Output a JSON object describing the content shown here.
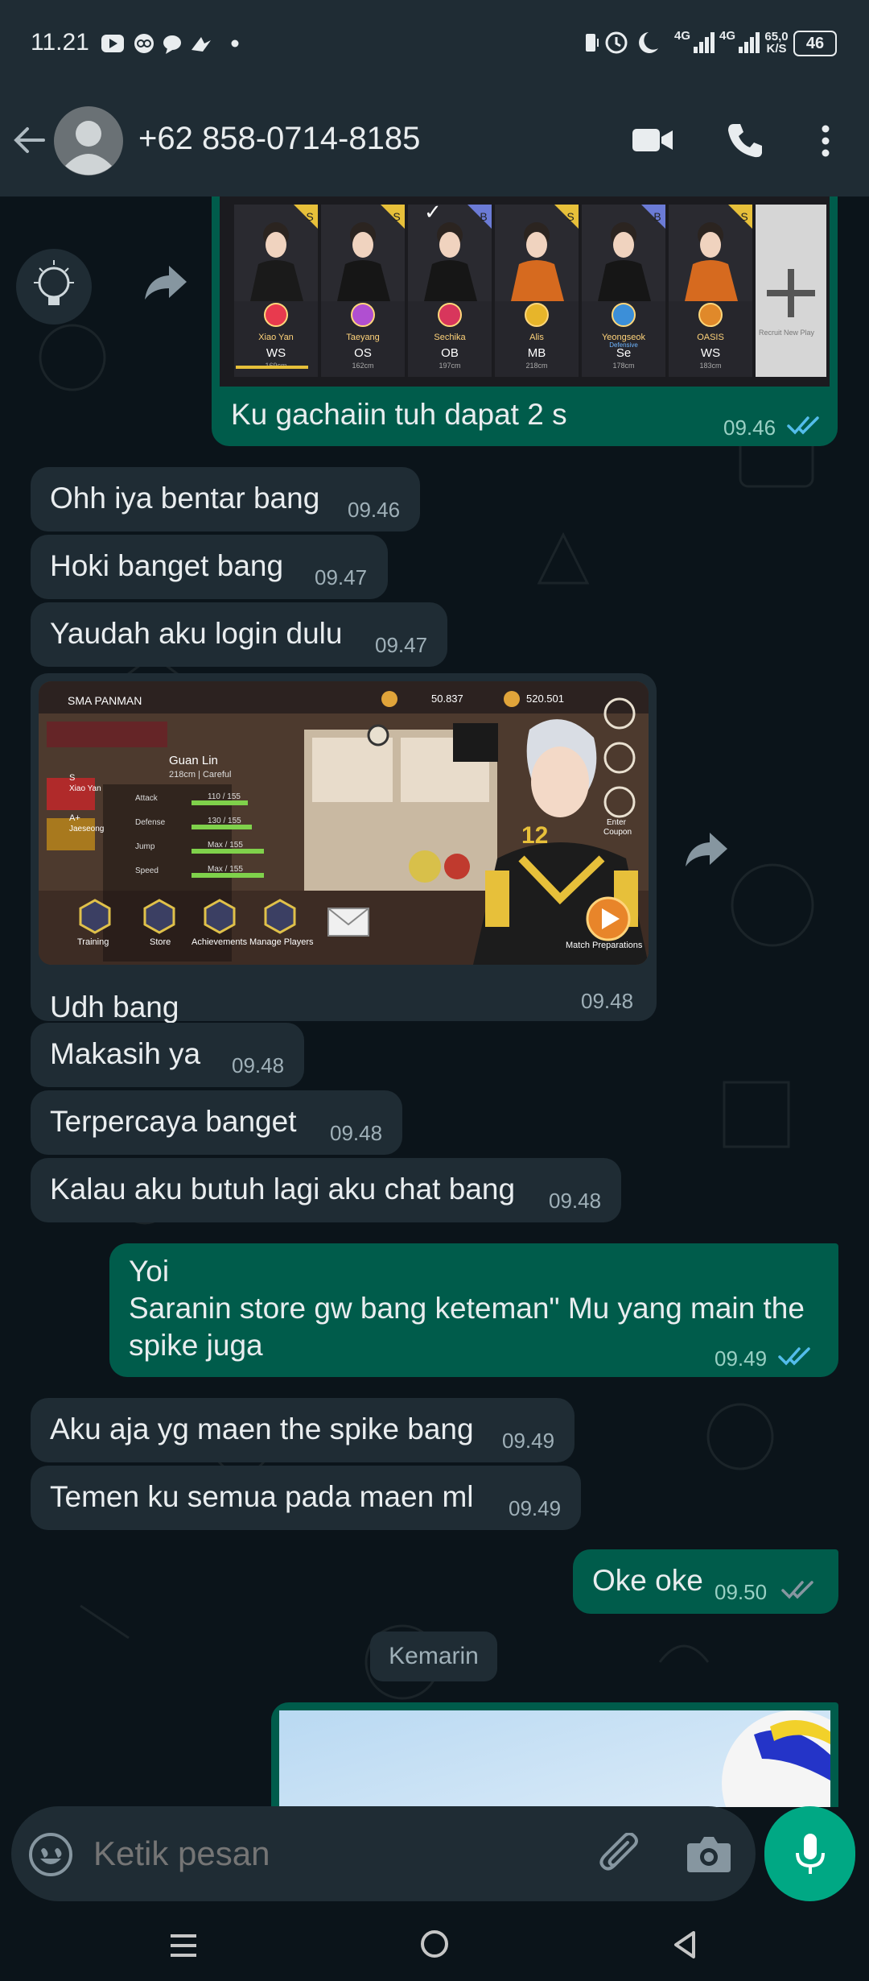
{
  "status_bar": {
    "time": "11.21",
    "net_speed": "65,0",
    "net_unit": "K/S",
    "battery": "46",
    "network_1": "4G",
    "network_2": "4G"
  },
  "header": {
    "contact": "+62 858-0714-8185"
  },
  "messages": [
    {
      "caption": "Ku gachaiin tuh dapat 2 s",
      "time": "09.46"
    },
    {
      "text": "Ohh iya bentar bang",
      "time": "09.46"
    },
    {
      "text": "Hoki banget bang",
      "time": "09.47"
    },
    {
      "text": "Yaudah aku login dulu",
      "time": "09.47"
    },
    {
      "caption": "Udh bang",
      "time": "09.48"
    },
    {
      "text": "Makasih ya",
      "time": "09.48"
    },
    {
      "text": "Terpercaya banget",
      "time": "09.48"
    },
    {
      "text": "Kalau aku butuh lagi aku chat bang",
      "time": "09.48"
    },
    {
      "text_line1": "Yoi",
      "text_line2": "Saranin store gw bang keteman\" Mu yang main the",
      "text_line3": "spike juga",
      "time": "09.49"
    },
    {
      "text": "Aku aja yg maen the spike bang",
      "time": "09.49"
    },
    {
      "text": "Temen ku semua pada maen ml",
      "time": "09.49"
    },
    {
      "text": "Oke oke",
      "time": "09.50"
    }
  ],
  "date_chip": "Kemarin",
  "game_card": {
    "players": [
      {
        "name": "Xiao Yan",
        "pos": "WS",
        "height": "169cm",
        "grade": "S",
        "color": "#e83a4e"
      },
      {
        "name": "Taeyang",
        "pos": "OS",
        "height": "162cm",
        "grade": "S",
        "color": "#b04fd1"
      },
      {
        "name": "Sechika",
        "pos": "OB",
        "height": "197cm",
        "grade": "B",
        "color": "#d8365c"
      },
      {
        "name": "Alis",
        "pos": "MB",
        "height": "218cm",
        "grade": "S",
        "color": "#e7b52a"
      },
      {
        "name": "Yeongseok",
        "pos": "Se",
        "height": "178cm",
        "grade": "B",
        "color": "#3c8fd8"
      },
      {
        "name": "OASIS",
        "pos": "WS",
        "height": "183cm",
        "grade": "S",
        "color": "#e0892a"
      }
    ],
    "recruit": "Recruit New Play",
    "sub": "Defensive",
    "checkmark": "✓"
  },
  "game_screen": {
    "school": "SMA PANMAN",
    "coins": "50.837",
    "gems": "520.501",
    "player": "Guan Lin",
    "player_info": "218cm | Careful",
    "grade_s": "S",
    "grade_a": "A+",
    "roster_1": "Xiao Yan",
    "roster_2": "Jaeseong",
    "jersey": "12",
    "stats": [
      {
        "label": "Attack",
        "value": "110 / 155"
      },
      {
        "label": "Defense",
        "value": "130 / 155"
      },
      {
        "label": "Jump",
        "value": "Max / 155"
      },
      {
        "label": "Speed",
        "value": "Max / 155"
      }
    ],
    "menu": [
      "Training",
      "Store",
      "Achievements",
      "Manage Players"
    ],
    "enter": "Enter",
    "coupon": "Coupon",
    "match": "Match Preparations"
  },
  "composer": {
    "placeholder": "Ketik pesan"
  },
  "colors": {
    "incoming": "#1f2c34",
    "outgoing": "#005c4b",
    "accent": "#00a884",
    "read_ticks": "#53bdeb",
    "sent_ticks": "#8696a0"
  },
  "icons": [
    "back-arrow-icon",
    "avatar-icon",
    "video-call-icon",
    "phone-icon",
    "more-vert-icon",
    "forward-icon",
    "emoji-icon",
    "attach-icon",
    "camera-icon",
    "mic-icon"
  ]
}
